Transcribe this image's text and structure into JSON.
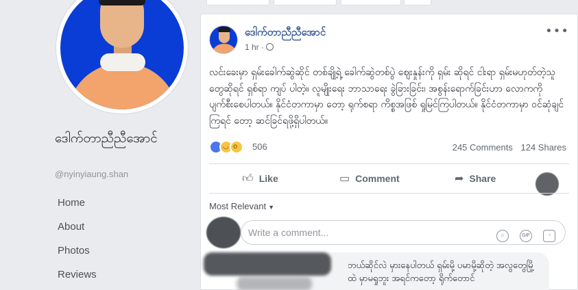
{
  "profile": {
    "name": "ဒေါက်တာညီညီအောင်",
    "handle": "@nyinyiaung.shan",
    "nav": [
      "Home",
      "About",
      "Photos",
      "Reviews"
    ]
  },
  "post": {
    "author": "ဒေါက်တာညီညီအောင်",
    "time": "1 hr",
    "more": "•••",
    "text": "လင်းခေးမှာ ရှမ်းခေါက်ဆွဲဆိုင် တစ်ချို့ရဲ့ ခေါက်ဆွဲတစ်ပွဲ ဈေးနှုန်းကို ရှမ်း ဆိုရင် ငါးရာ ရှမ်းမဟုတ်တဲ့သူတွေဆိုရင် ရှစ်ရာ ကျပ် ပါတဲ့။ လူမျိုးရေး ဘာသာရေး ခွဲခြားခြင်း၊ အစွန်းရောက်ခြင်းဟာ လောကကို ပျက်စီးစေပါတယ်။ နိုင်ငံတကာမှာ တော့ ရုက်စရာ ကိစ္စအဖြစ် ရှုမြင်ကြပါတယ်။ နိုင်ငံတကာမှာ ဝင်ဆုံချင်ကြရင် တော့ ဆင်ခြင်ရဖို့ရှိပါတယ်။",
    "reaction_count": "506",
    "comments": "245 Comments",
    "shares": "124 Shares",
    "actions": {
      "like": "Like",
      "comment": "Comment",
      "share": "Share"
    },
    "sort_label": "Most Relevant",
    "comment_placeholder": "Write a comment...",
    "comment_icons": {
      "gif": "GIF"
    },
    "first_comment": "ဘယ်ဆိုင်လဲ မှားနေပါတယ် ရှမ်းမို့ ပမာမို့ဆိုတဲ့ အလွတွေမြို့ထဲ မှာမရှုဘူး အရင်ကတော့ ရိုက်တောင်"
  },
  "colors": {
    "link": "#365899",
    "background": "#e9ebee",
    "like_blue": "#4a76e8",
    "avatar_bg": "#0a3dd6"
  }
}
